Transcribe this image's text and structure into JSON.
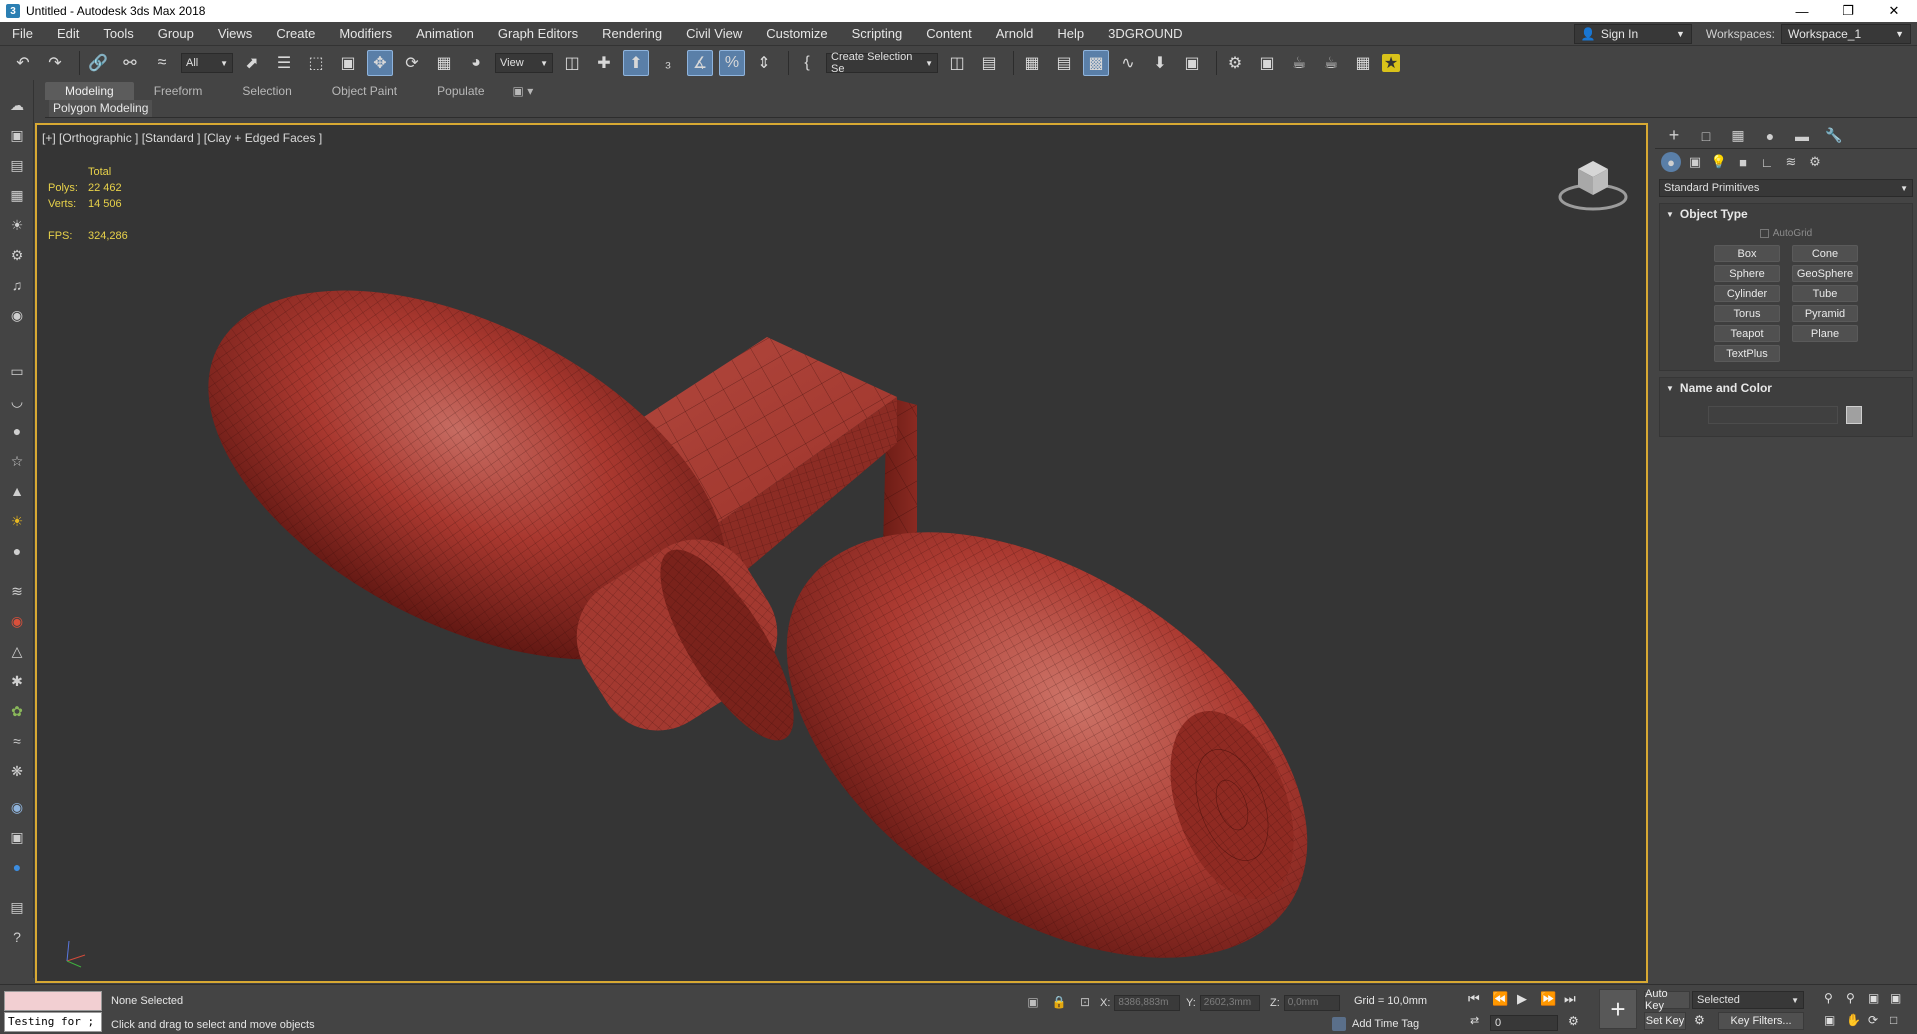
{
  "window": {
    "title": "Untitled - Autodesk 3ds Max 2018",
    "app_icon": "3",
    "controls": [
      "minimize-icon",
      "restore-icon",
      "close-icon"
    ]
  },
  "menu": {
    "items": [
      "File",
      "Edit",
      "Tools",
      "Group",
      "Views",
      "Create",
      "Modifiers",
      "Animation",
      "Graph Editors",
      "Rendering",
      "Civil View",
      "Customize",
      "Scripting",
      "Content",
      "Arnold",
      "Help",
      "3DGROUND"
    ],
    "sign_in": "Sign In",
    "workspaces_label": "Workspaces:",
    "workspace_value": "Workspace_1"
  },
  "toolbar": {
    "selection_filter": "All",
    "ref_coord": "View",
    "named_selection": "Create Selection Se"
  },
  "ribbon": {
    "tabs": [
      "Modeling",
      "Freeform",
      "Selection",
      "Object Paint",
      "Populate"
    ],
    "active_tab": "Modeling",
    "panel_label": "Polygon Modeling"
  },
  "viewport": {
    "label": "[+] [Orthographic ] [Standard ] [Clay + Edged Faces ]",
    "stats": {
      "total_label": "Total",
      "polys_label": "Polys:",
      "polys_value": "22 462",
      "verts_label": "Verts:",
      "verts_value": "14 506",
      "fps_label": "FPS:",
      "fps_value": "324,286"
    },
    "model_color": "#a8322c",
    "border_color": "#d8a933"
  },
  "command_panel": {
    "category": "Standard Primitives",
    "object_type_title": "Object Type",
    "autogrid_label": "AutoGrid",
    "primitives": [
      "Box",
      "Cone",
      "Sphere",
      "GeoSphere",
      "Cylinder",
      "Tube",
      "Torus",
      "Pyramid",
      "Teapot",
      "Plane",
      "TextPlus"
    ],
    "name_color_title": "Name and Color"
  },
  "status": {
    "selection_text": "None Selected",
    "prompt_text": "Click and drag to select and move objects",
    "maxscript_text": "Testing for ;",
    "x_label": "X:",
    "x_value": "8386,883m",
    "y_label": "Y:",
    "y_value": "2602,3mm",
    "z_label": "Z:",
    "z_value": "0,0mm",
    "grid_text": "Grid = 10,0mm",
    "add_time_tag": "Add Time Tag",
    "auto_key": "Auto Key",
    "set_key": "Set Key",
    "key_mode_value": "Selected",
    "key_filters": "Key Filters...",
    "frame_value": "0"
  }
}
